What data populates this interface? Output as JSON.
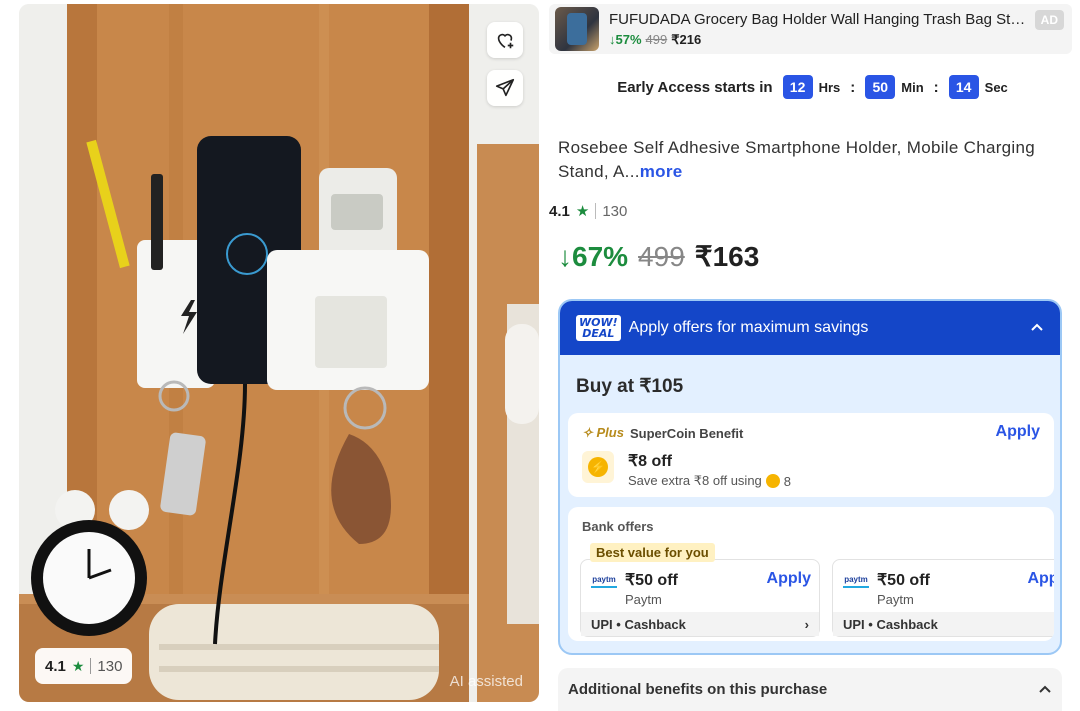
{
  "image": {
    "rating": "4.1",
    "rating_count": "130",
    "ai_note": "AI assisted",
    "icons": [
      "wishlist-icon",
      "share-icon",
      "star-icon"
    ]
  },
  "ad": {
    "title": "FUFUDADA Grocery Bag Holder Wall Hanging Trash Bag Sto...",
    "discount": "↓57%",
    "mrp": "499",
    "price": "₹216",
    "badge": "AD"
  },
  "early_access": {
    "label": "Early Access starts in",
    "hrs": "12",
    "hrs_unit": "Hrs",
    "min": "50",
    "min_unit": "Min",
    "sec": "14",
    "sec_unit": "Sec",
    "colon": ":"
  },
  "product": {
    "title": "Rosebee Self Adhesive Smartphone Holder, Mobile Charging Stand, A...",
    "more": "more",
    "rating": "4.1",
    "rating_count": "130",
    "discount": "↓67%",
    "mrp": "499",
    "price": "₹163"
  },
  "offers": {
    "wow_line1": "WOW!",
    "wow_line2": "DEAL",
    "header": "Apply offers for maximum savings",
    "buy_at": "Buy at ₹105",
    "supercoin": {
      "plus": "✧ Plus",
      "label": "SuperCoin Benefit",
      "apply": "Apply",
      "off": "₹8 off",
      "sub": "Save extra ₹8 off using",
      "coins": "8"
    },
    "bank": {
      "label": "Bank offers",
      "best": "Best value for you",
      "items": [
        {
          "logo": "paytm",
          "off": "₹50 off",
          "name": "Paytm",
          "apply": "Apply",
          "foot": "UPI • Cashback",
          "arrow": "›"
        },
        {
          "logo": "paytm",
          "off": "₹50 off",
          "name": "Paytm",
          "apply": "Appl",
          "foot": "UPI • Cashback",
          "arrow": ""
        }
      ]
    }
  },
  "additional": {
    "label": "Additional benefits on this purchase",
    "chevron": "^"
  },
  "colors": {
    "accent_blue": "#2a55e5",
    "deal_blue": "#1446c8",
    "green": "#1c8c3e",
    "offer_bg": "#e3f0ff"
  }
}
